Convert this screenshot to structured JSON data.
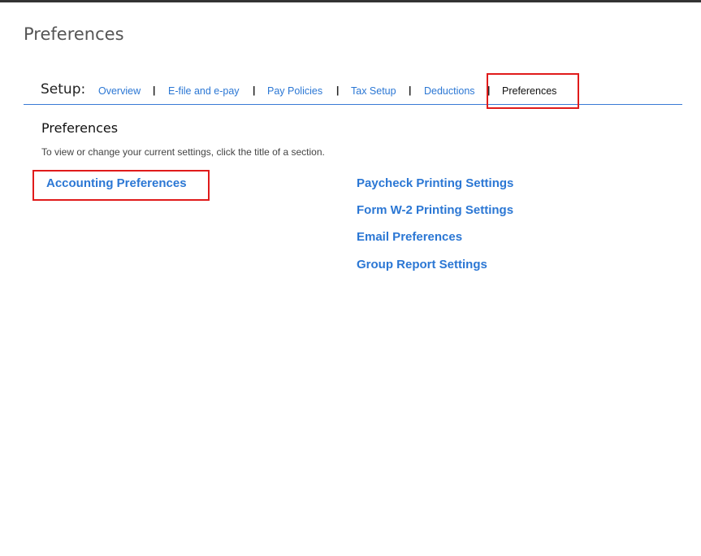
{
  "page": {
    "title": "Preferences"
  },
  "setup_nav": {
    "label": "Setup:",
    "separator": "|",
    "items": [
      {
        "label": "Overview"
      },
      {
        "label": "E-file and e-pay"
      },
      {
        "label": "Pay Policies"
      },
      {
        "label": "Tax Setup"
      },
      {
        "label": "Deductions"
      },
      {
        "label": "Preferences",
        "active": true
      }
    ]
  },
  "section": {
    "title": "Preferences",
    "description": "To view or change your current settings, click the title of a section."
  },
  "links": {
    "left": [
      {
        "label": "Accounting Preferences"
      }
    ],
    "right": [
      {
        "label": "Paycheck Printing Settings"
      },
      {
        "label": "Form W-2 Printing Settings"
      },
      {
        "label": "Email Preferences"
      },
      {
        "label": "Group Report Settings"
      }
    ]
  },
  "colors": {
    "link": "#2b77d4",
    "highlight": "#e01b1b",
    "nav_rule": "#3a7bd5"
  }
}
